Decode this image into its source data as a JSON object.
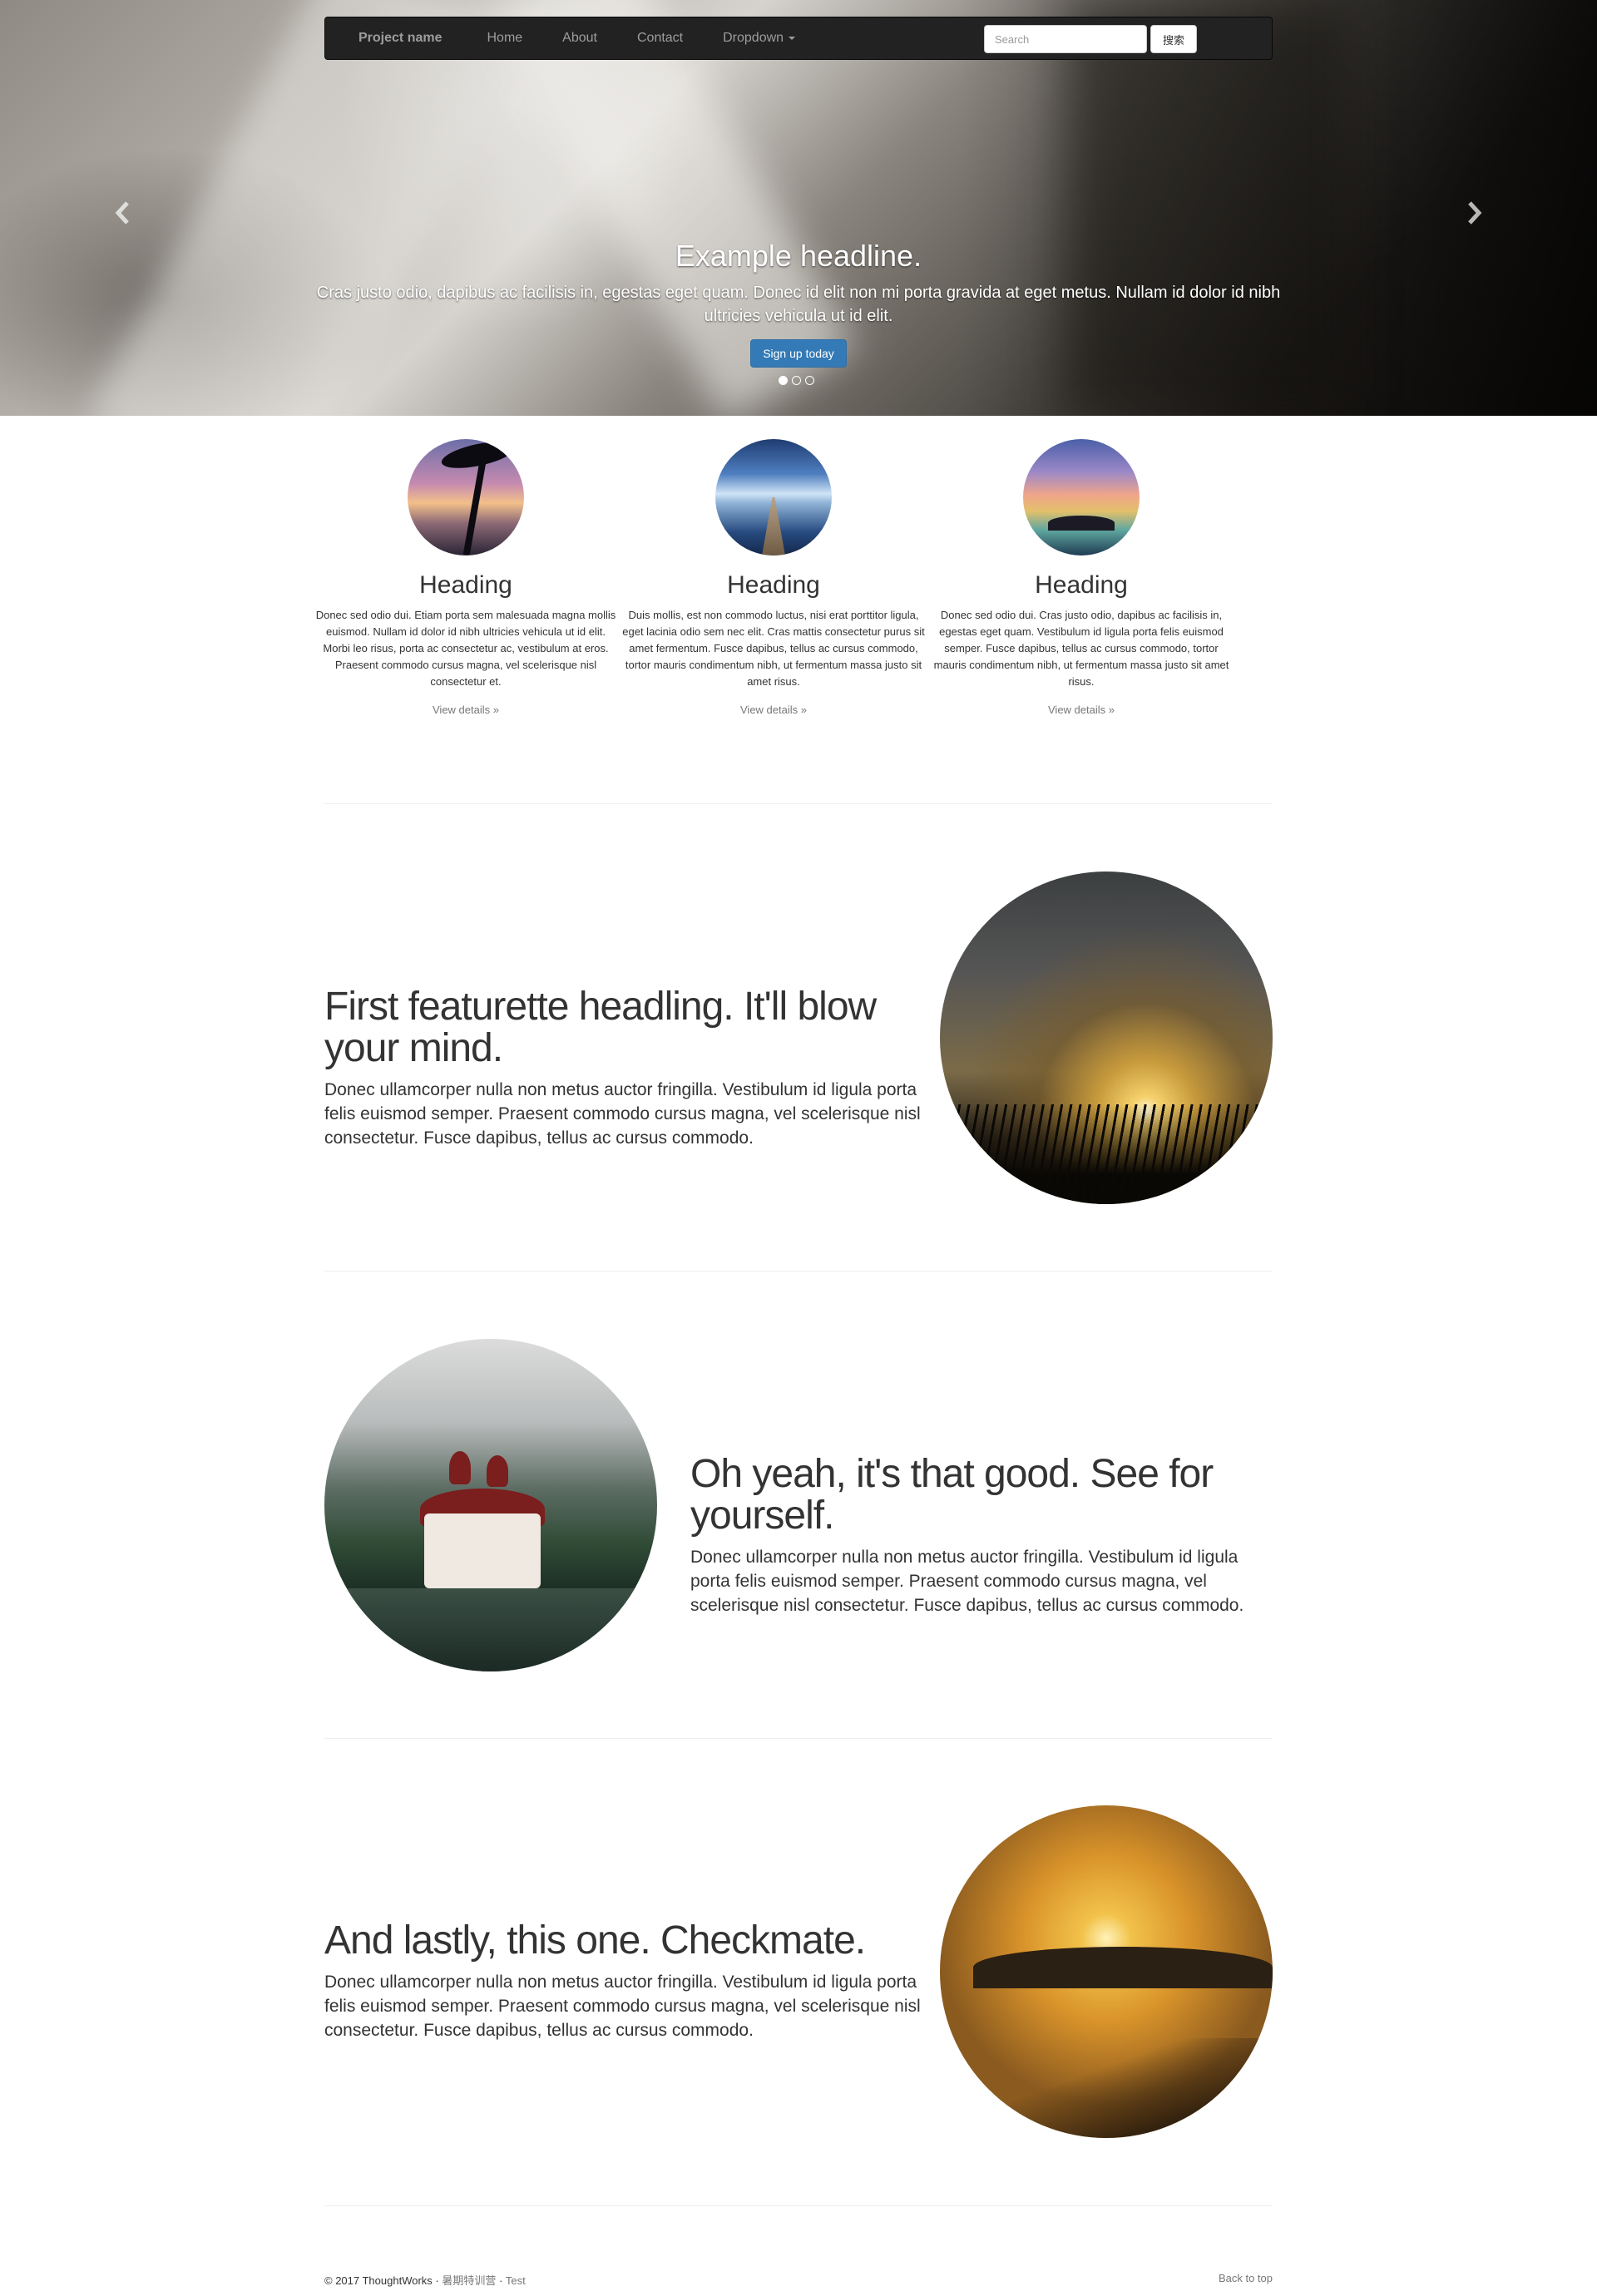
{
  "navbar": {
    "brand": "Project name",
    "links": [
      "Home",
      "About",
      "Contact",
      "Dropdown"
    ],
    "search_placeholder": "Search",
    "search_button": "搜索"
  },
  "carousel": {
    "headline": "Example headline.",
    "text": "Cras justo odio, dapibus ac facilisis in, egestas eget quam. Donec id elit non mi porta gravida at eget metus. Nullam id dolor id nibh ultricies vehicula ut id elit.",
    "button": "Sign up today",
    "slides": 3,
    "active_slide": 1
  },
  "columns": [
    {
      "heading": "Heading",
      "text": "Donec sed odio dui. Etiam porta sem malesuada magna mollis euismod. Nullam id dolor id nibh ultricies vehicula ut id elit. Morbi leo risus, porta ac consectetur ac, vestibulum at eros. Praesent commodo cursus magna, vel scelerisque nisl consectetur et.",
      "link": "View details »"
    },
    {
      "heading": "Heading",
      "text": "Duis mollis, est non commodo luctus, nisi erat porttitor ligula, eget lacinia odio sem nec elit. Cras mattis consectetur purus sit amet fermentum. Fusce dapibus, tellus ac cursus commodo, tortor mauris condimentum nibh, ut fermentum massa justo sit amet risus.",
      "link": "View details »"
    },
    {
      "heading": "Heading",
      "text": "Donec sed odio dui. Cras justo odio, dapibus ac facilisis in, egestas eget quam. Vestibulum id ligula porta felis euismod semper. Fusce dapibus, tellus ac cursus commodo, tortor mauris condimentum nibh, ut fermentum massa justo sit amet risus.",
      "link": "View details »"
    }
  ],
  "featurettes": [
    {
      "heading": "First featurette headling. It'll blow your mind.",
      "text": "Donec ullamcorper nulla non metus auctor fringilla. Vestibulum id ligula porta felis euismod semper. Praesent commodo cursus magna, vel scelerisque nisl consectetur. Fusce dapibus, tellus ac cursus commodo."
    },
    {
      "heading": "Oh yeah, it's that good. See for yourself.",
      "text": "Donec ullamcorper nulla non metus auctor fringilla. Vestibulum id ligula porta felis euismod semper. Praesent commodo cursus magna, vel scelerisque nisl consectetur. Fusce dapibus, tellus ac cursus commodo."
    },
    {
      "heading": "And lastly, this one. Checkmate.",
      "text": "Donec ullamcorper nulla non metus auctor fringilla. Vestibulum id ligula porta felis euismod semper. Praesent commodo cursus magna, vel scelerisque nisl consectetur. Fusce dapibus, tellus ac cursus commodo."
    }
  ],
  "footer": {
    "copyright": "© 2017 ThoughtWorks · ",
    "link_1": "暑期特训营",
    "separator": " · ",
    "link_2": "Test",
    "back_to_top": "Back to top"
  },
  "colors": {
    "navbar_bg": "#222222",
    "primary_button": "#337ab7",
    "muted_text": "#777777"
  },
  "icons": [
    "chevron-left-icon",
    "chevron-right-icon"
  ]
}
